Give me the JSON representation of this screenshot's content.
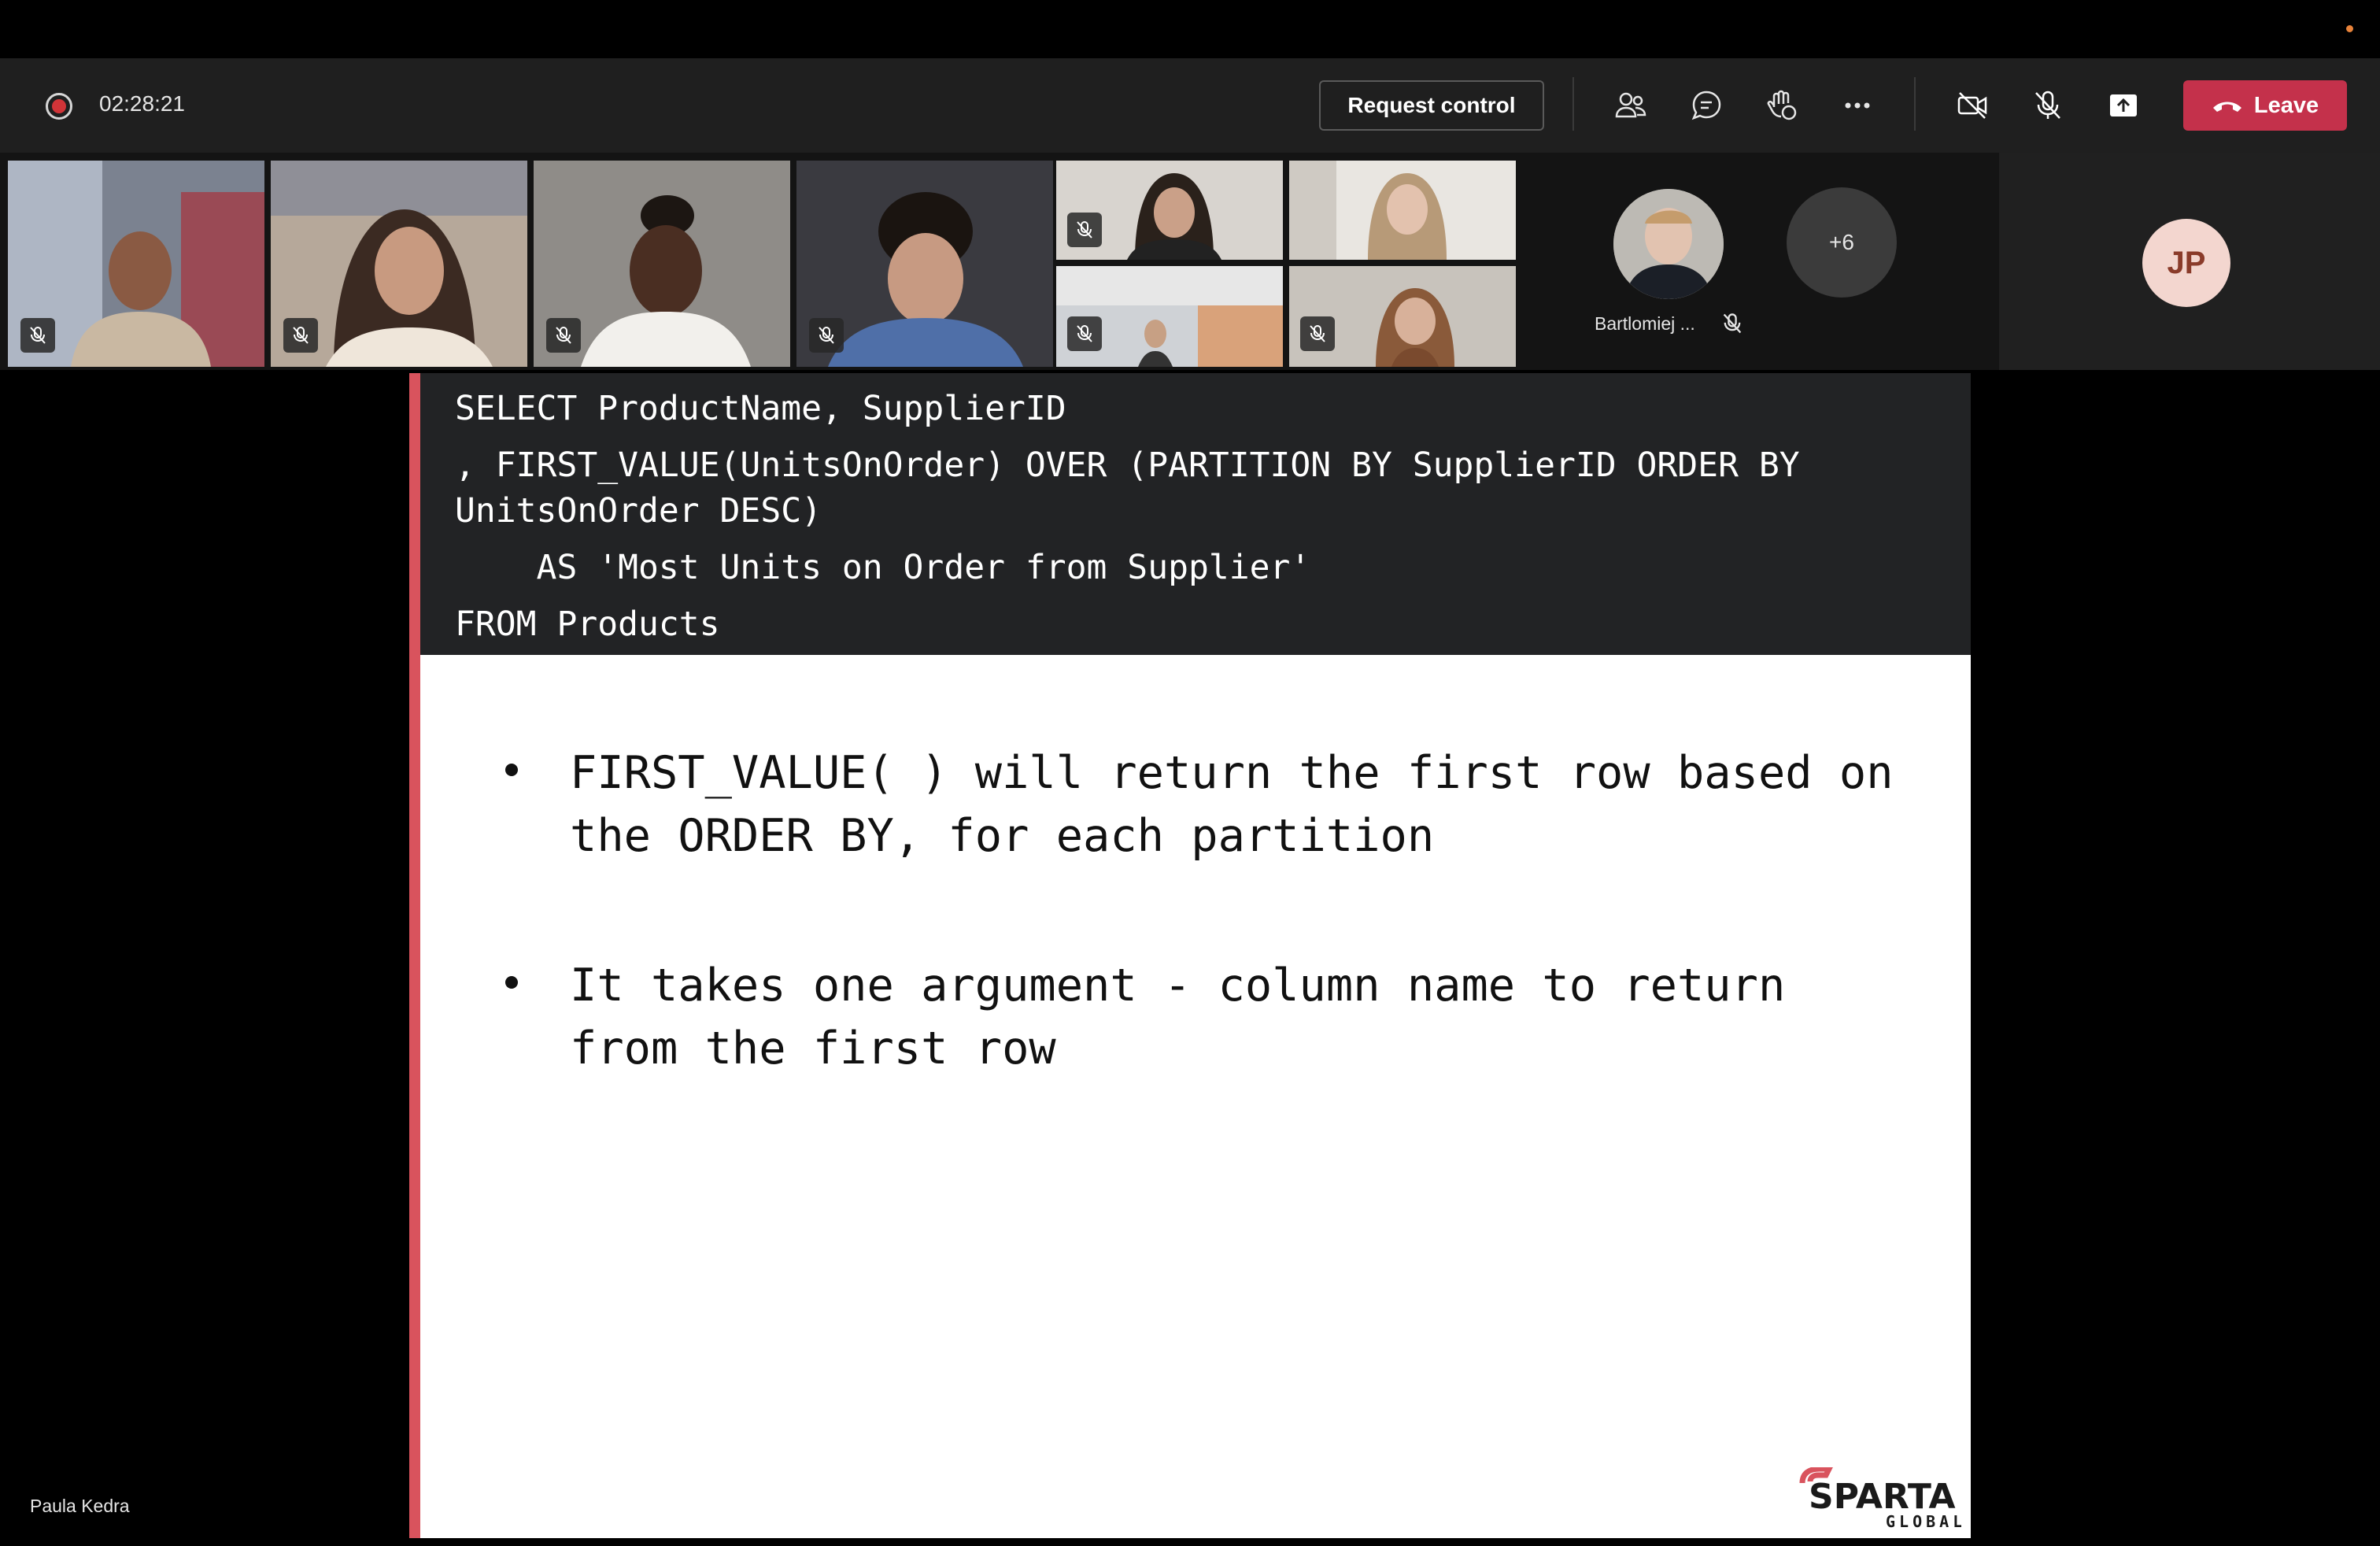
{
  "call": {
    "timer": "02:28:21",
    "request_control_label": "Request control",
    "leave_label": "Leave",
    "toolbar_icons": [
      "people-icon",
      "chat-icon",
      "raise-hand-icon",
      "more-icon",
      "camera-off-icon",
      "mic-off-icon",
      "share-tray-icon"
    ]
  },
  "participants": {
    "featured_name": "Bartlomiej ...",
    "overflow_count": "+6",
    "initials_tile": "JP"
  },
  "slide": {
    "code_lines": [
      "SELECT ProductName, SupplierID",
      ", FIRST_VALUE(UnitsOnOrder) OVER (PARTITION BY SupplierID ORDER BY",
      "UnitsOnOrder DESC)",
      "    AS 'Most Units on Order from Supplier'",
      "FROM Products"
    ],
    "bullets": [
      {
        "line1": "FIRST_VALUE( ) will return the first row based on",
        "line2": "the ORDER BY, for each partition"
      },
      {
        "line1": "It takes one argument - column name to return",
        "line2": "from the first row"
      }
    ],
    "logo_word": "SPARTA",
    "logo_sub": "GLOBAL"
  },
  "presenter_name": "Paula Kedra",
  "colors": {
    "leave": "#c4314b",
    "accent_bar": "#d9535d",
    "active_outline": "#9ea2ff"
  }
}
